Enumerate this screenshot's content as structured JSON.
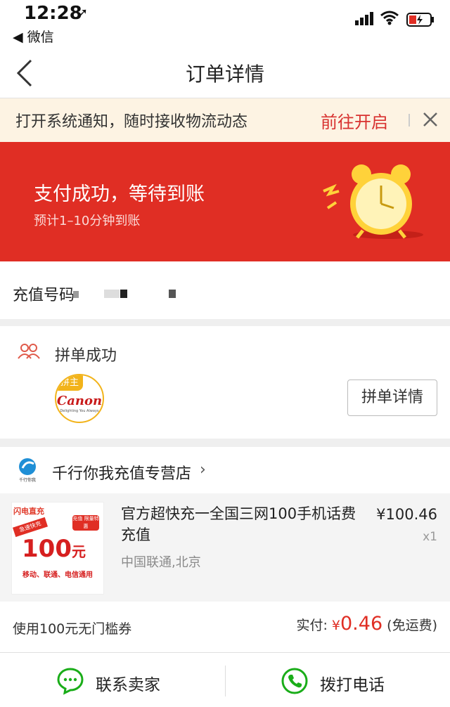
{
  "status_bar": {
    "time": "12:28",
    "back_app": "◀ 微信"
  },
  "nav": {
    "title": "订单详情"
  },
  "notice": {
    "text": "打开系统通知，随时接收物流动态",
    "action": "前往开启"
  },
  "payment": {
    "title": "支付成功，等待到账",
    "subtitle": "预计1–10分钟到账"
  },
  "recharge": {
    "label": "充值号码"
  },
  "group": {
    "status": "拼单成功",
    "badge": "拼主",
    "brand": "Canon",
    "slogan": "Delighting You Always",
    "detail_button": "拼单详情"
  },
  "store": {
    "name": "千行你我充值专营店",
    "logo_caption": "千行你我",
    "product": {
      "title": "官方超快充一全国三网100手机话费充值",
      "spec": "中国联通,北京",
      "price": "¥100.46",
      "quantity": "x1",
      "thumb_brand": "闪电直充",
      "thumb_tag": "充值 限量特惠",
      "thumb_ribbon": "急速快充",
      "thumb_amount": "100",
      "thumb_unit": "元",
      "thumb_foot": "移动、联通、电信通用"
    }
  },
  "summary": {
    "coupon": "使用100元无门槛券",
    "paid_label": "实付:",
    "currency": "¥",
    "paid_int": "0.",
    "paid_dec": "46",
    "shipping": "(免运费)"
  },
  "actions": {
    "contact_seller": "联系卖家",
    "call": "拨打电话"
  }
}
